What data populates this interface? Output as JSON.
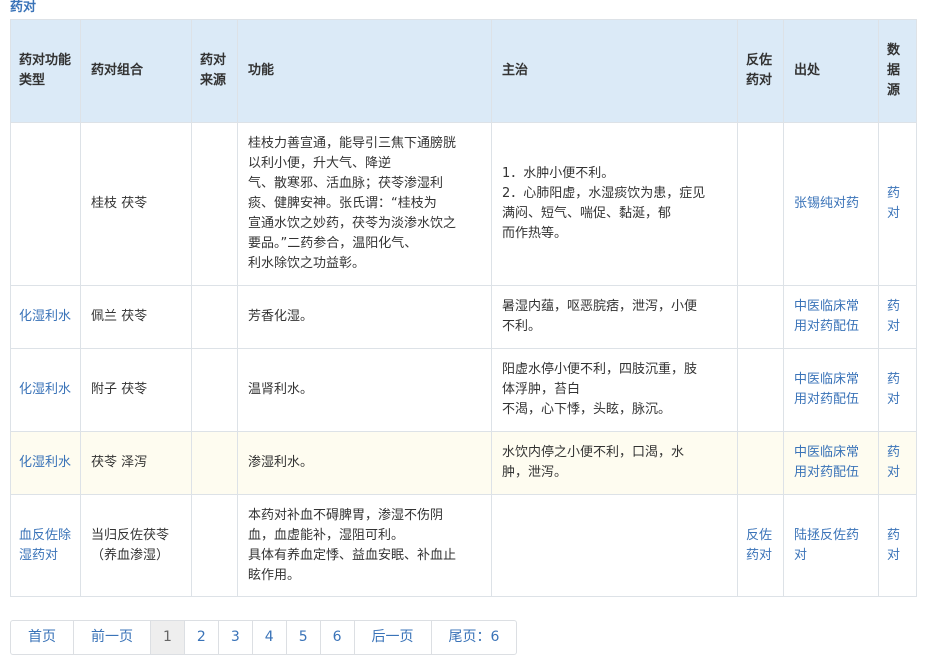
{
  "section_title": "药对",
  "headers": {
    "type": "药对功能类型",
    "combo": "药对组合",
    "source": "药对来源",
    "function": "功能",
    "indication": "主治",
    "counter": "反佐药对",
    "origin": "出处",
    "datasource": "数据源"
  },
  "rows": [
    {
      "type": "",
      "combo": "桂枝 茯苓",
      "source": "",
      "function": [
        "桂枝力善宣通，能导引三焦下通膀胱",
        "以利小便，升大气、降逆",
        "气、散寒邪、活血脉；茯苓渗湿利",
        "痰、健脾安神。张氏谓：“桂枝为",
        "宣通水饮之妙药，茯苓为淡渗水饮之",
        "要品。”二药参合，温阳化气、",
        "利水除饮之功益彰。"
      ],
      "indication": [
        "1．水肿小便不利。",
        "2．心肺阳虚，水湿痰饮为患，症见",
        "满闷、短气、喘促、黏涎，郁",
        "而作热等。"
      ],
      "counter": "",
      "origin": "张锡纯对药",
      "datasource": "药对"
    },
    {
      "type": "化湿利水",
      "combo": "佩兰 茯苓",
      "source": "",
      "function": [
        "芳香化湿。"
      ],
      "indication": [
        "暑湿内蕴，呕恶脘痞，泄泻，小便",
        "不利。"
      ],
      "counter": "",
      "origin": "中医临床常用对药配伍",
      "datasource": "药对"
    },
    {
      "type": "化湿利水",
      "combo": "附子 茯苓",
      "source": "",
      "function": [
        "温肾利水。"
      ],
      "indication": [
        "阳虚水停小便不利，四肢沉重，肢",
        "体浮肿，苔白",
        "不渴，心下悸，头眩，脉沉。"
      ],
      "counter": "",
      "origin": "中医临床常用对药配伍",
      "datasource": "药对"
    },
    {
      "type": "化湿利水",
      "combo": "茯苓 泽泻",
      "source": "",
      "function": [
        "渗湿利水。"
      ],
      "indication": [
        "水饮内停之小便不利，口渴，水",
        "肿，泄泻。"
      ],
      "counter": "",
      "origin": "中医临床常用对药配伍",
      "datasource": "药对"
    },
    {
      "type": "血反佐除湿药对",
      "combo": "当归反佐茯苓（养血渗湿）",
      "source": "",
      "function": [
        "本药对补血不碍脾胃，渗湿不伤阴",
        "血，血虚能补，湿阻可利。",
        "具体有养血定悸、益血安眠、补血止",
        "眩作用。"
      ],
      "indication": [],
      "counter": "反佐药对",
      "origin": "陆拯反佐药对",
      "datasource": "药对"
    }
  ],
  "pager": {
    "first": "首页",
    "prev": "前一页",
    "pages": [
      "1",
      "2",
      "3",
      "4",
      "5",
      "6"
    ],
    "current": "1",
    "next": "后一页",
    "last": "尾页：6"
  }
}
